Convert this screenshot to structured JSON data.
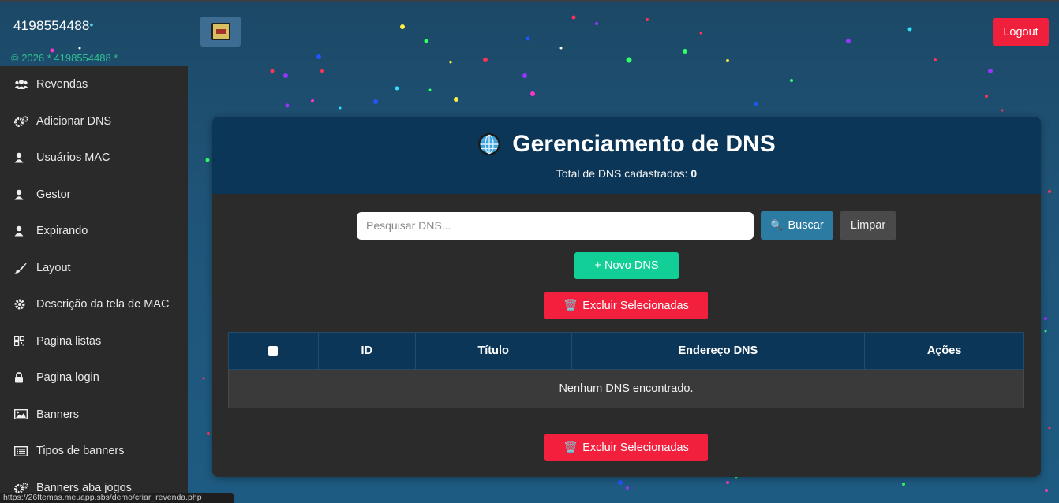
{
  "sidebar": {
    "brand": "4198554488",
    "brand_dot": "•",
    "copyright": "© 2026 * 4198554488 *",
    "items": [
      {
        "label": "Revendas",
        "icon": "users-icon"
      },
      {
        "label": "Adicionar DNS",
        "icon": "gears-icon"
      },
      {
        "label": "Usuários MAC",
        "icon": "user-icon"
      },
      {
        "label": "Gestor",
        "icon": "user-icon"
      },
      {
        "label": "Expirando",
        "icon": "user-icon"
      },
      {
        "label": "Layout",
        "icon": "brush-icon"
      },
      {
        "label": "Descrição da tela de MAC",
        "icon": "gear-icon"
      },
      {
        "label": "Pagina listas",
        "icon": "qrcode-icon"
      },
      {
        "label": "Pagina login",
        "icon": "lock-icon"
      },
      {
        "label": "Banners",
        "icon": "image-icon"
      },
      {
        "label": "Tipos de banners",
        "icon": "list-icon"
      },
      {
        "label": "Banners aba jogos",
        "icon": "gears-icon"
      }
    ]
  },
  "topbar": {
    "logout_label": "Logout"
  },
  "card": {
    "title": "Gerenciamento de DNS",
    "subtitle_prefix": "Total de DNS cadastrados:",
    "total": "0"
  },
  "search": {
    "placeholder": "Pesquisar DNS...",
    "buscar_label": "Buscar",
    "buscar_icon": "🔍",
    "limpar_label": "Limpar"
  },
  "actions": {
    "novo_label": "+ Novo DNS",
    "excluir_label": "Excluir Selecionadas",
    "excluir_icon": "🗑️"
  },
  "table": {
    "headers": [
      "ID",
      "Título",
      "Endereço DNS",
      "Ações"
    ],
    "empty_message": "Nenhum DNS encontrado."
  },
  "statusbar": {
    "url": "https://26ftemas.meuapp.sbs/demo/criar_revenda.php"
  },
  "colors": {
    "accent_red": "#f0203c",
    "accent_green": "#12cf97",
    "accent_blue": "#2b7ba3",
    "header_navy": "#0c3657"
  }
}
